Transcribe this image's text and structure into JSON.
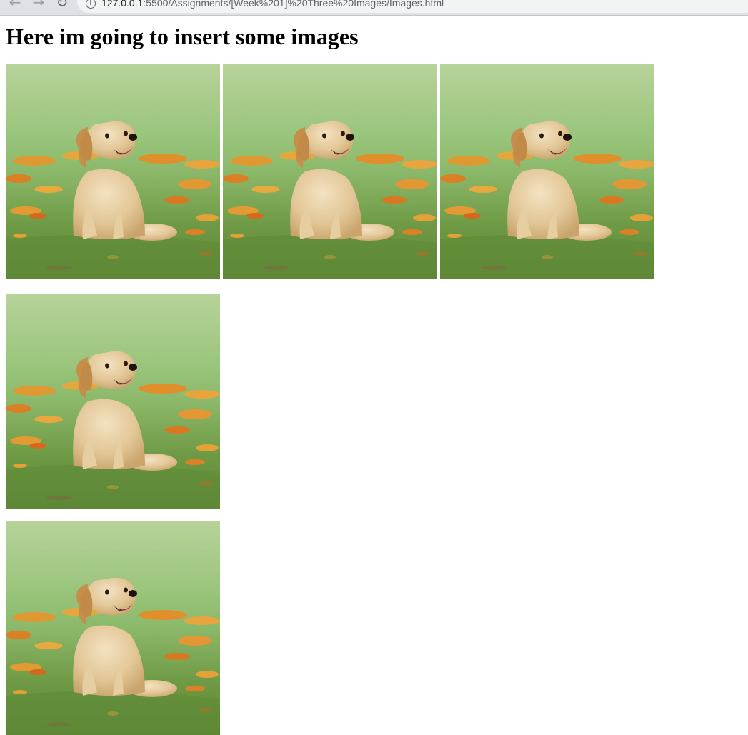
{
  "browser": {
    "url_host": "127.0.0.1",
    "url_rest": ":5500/Assignments/[Week%201]%20Three%20Images/Images.html",
    "back_icon": "arrow-left-icon",
    "forward_icon": "arrow-right-icon",
    "reload_icon": "reload-icon",
    "info_icon": "info-icon"
  },
  "page": {
    "heading": "Here im going to insert some images"
  },
  "images": [
    {
      "subject": "golden retriever puppy sitting in grass with orange flowers"
    },
    {
      "subject": "golden retriever puppy sitting in grass with orange flowers"
    },
    {
      "subject": "golden retriever puppy sitting in grass with orange flowers"
    },
    {
      "subject": "golden retriever puppy sitting in grass with orange flowers"
    },
    {
      "subject": "golden retriever puppy sitting in grass with orange flowers"
    }
  ]
}
